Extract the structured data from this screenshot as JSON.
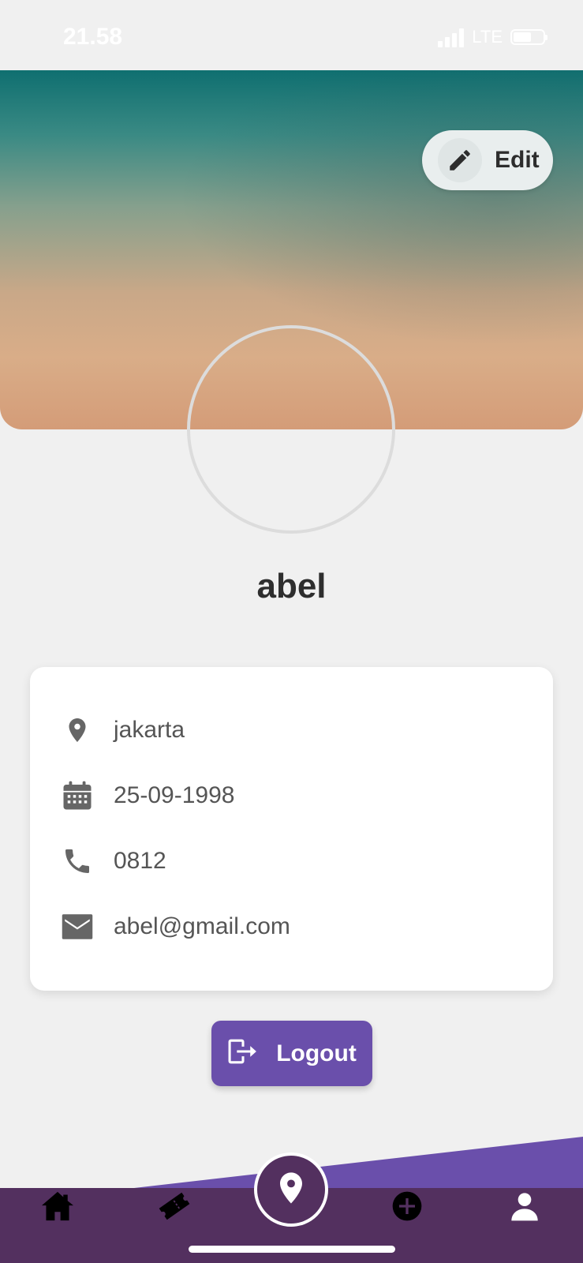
{
  "status_bar": {
    "time": "21.58",
    "network": "LTE"
  },
  "header": {
    "edit_label": "Edit"
  },
  "profile": {
    "name": "abel"
  },
  "info": {
    "location": "jakarta",
    "birthdate": "25-09-1998",
    "phone": "0812",
    "email": "abel@gmail.com"
  },
  "actions": {
    "logout_label": "Logout"
  },
  "bottom_nav": {
    "items": [
      "home-icon",
      "ticket-icon",
      "map-pin-icon",
      "add-circle-icon",
      "person-icon"
    ],
    "active": "person-icon"
  },
  "colors": {
    "accent": "#6a4fab",
    "nav_bg": "#53305f",
    "background": "#f0f0f0",
    "text": "#2e2e2e",
    "icon_gray": "#666666"
  }
}
